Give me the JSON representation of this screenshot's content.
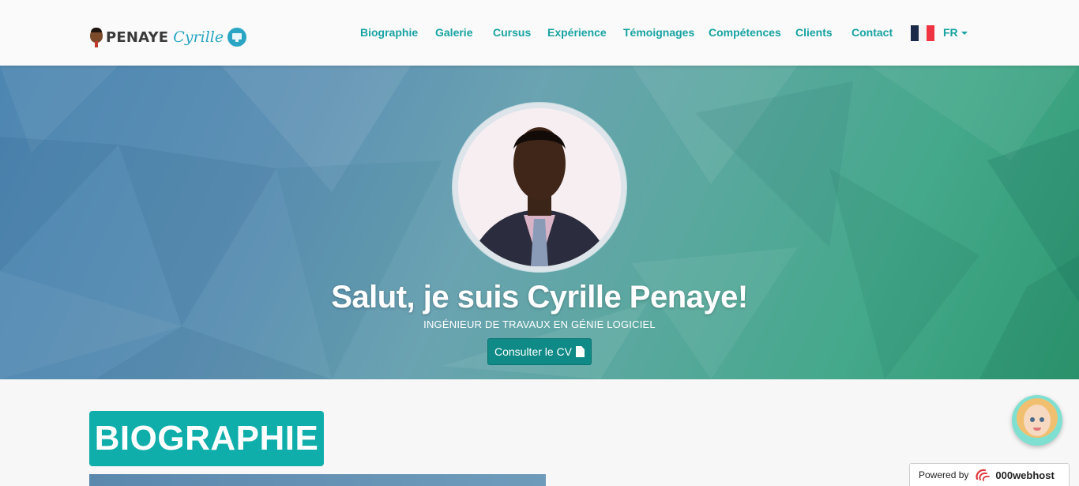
{
  "brand": {
    "first": "PENAYE",
    "last": "Cyrille"
  },
  "nav": {
    "items": [
      {
        "label": "Biographie"
      },
      {
        "label": "Galerie"
      },
      {
        "label": "Cursus"
      },
      {
        "label": "Expérience"
      },
      {
        "label": "Témoignages"
      },
      {
        "label": "Compétences"
      },
      {
        "label": "Clients"
      },
      {
        "label": "Contact"
      }
    ],
    "language": "FR"
  },
  "hero": {
    "greeting": "Salut, je suis ",
    "name": "Cyrille Penaye!",
    "subtitle": "INGÉNIEUR DE TRAVAUX EN GÉNIE LOGICIEL",
    "cv_button": "Consulter le CV"
  },
  "biography": {
    "heading": "BIOGRAPHIE"
  },
  "widget": {
    "powered_by": "Powered by",
    "host": "000webhost"
  },
  "colors": {
    "accent": "#17a2a2",
    "heading_bg": "#10aeaa",
    "button_bg": "#0f8a86",
    "brand_last": "#2aa6c4"
  },
  "icons": [
    "brand-avatar-icon",
    "monitor-icon",
    "french-flag-icon",
    "caret-down-icon",
    "document-icon",
    "chat-avatar-icon",
    "webhost-logo-icon"
  ]
}
